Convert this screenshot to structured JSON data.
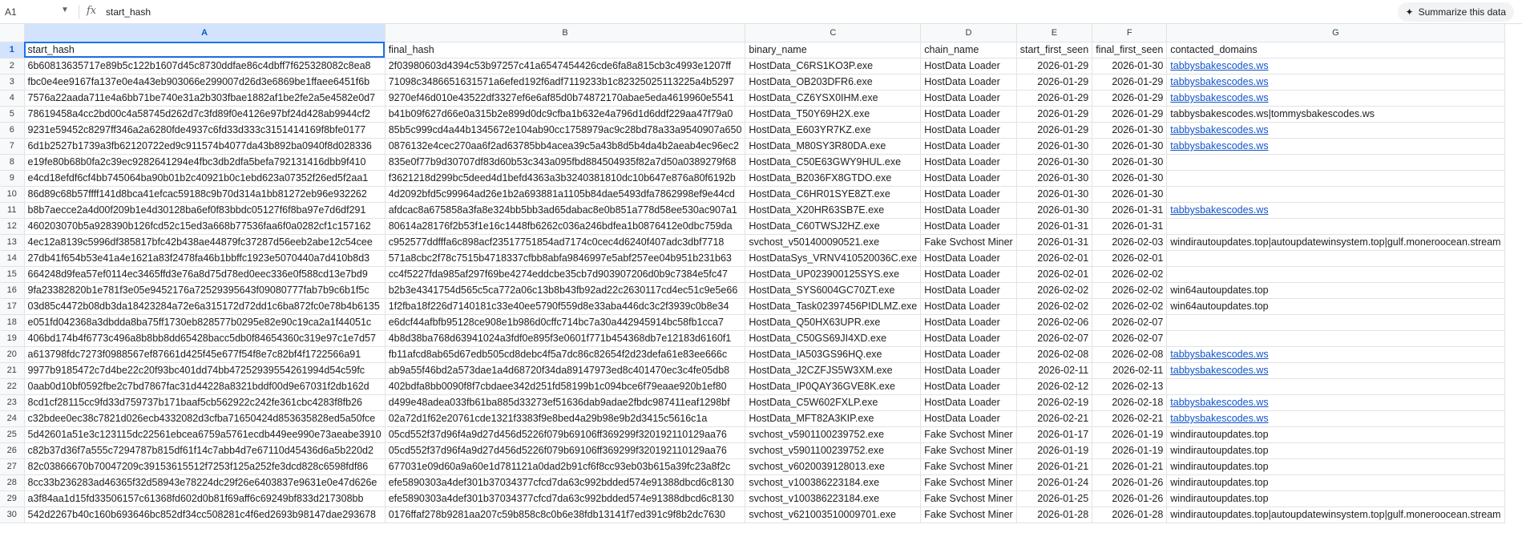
{
  "name_box": "A1",
  "formula": "start_hash",
  "summarize_label": "Summarize this data",
  "columns": [
    "A",
    "B",
    "C",
    "D",
    "E",
    "F",
    "G"
  ],
  "colors": {
    "link": "#1155cc",
    "selection": "#1a73e8",
    "header_active": "#d3e3fd"
  },
  "rows": [
    {
      "n": "1",
      "c": [
        "start_hash",
        "final_hash",
        "binary_name",
        "chain_name",
        "start_first_seen",
        "final_first_seen",
        "contacted_domains"
      ],
      "link": false
    },
    {
      "n": "2",
      "c": [
        "6b60813635717e89b5c122b1607d45c8730ddfae86c4dbff7f625328082c8ea8",
        "2f03980603d4394c53b97257c41a6547454426cde6fa8a815cb3c4993e1207ff",
        "HostData_C6RS1KO3P.exe",
        "HostData Loader",
        "2026-01-29",
        "2026-01-30",
        "tabbysbakescodes.ws"
      ],
      "link": true
    },
    {
      "n": "3",
      "c": [
        "fbc0e4ee9167fa137e0e4a43eb903066e299007d26d3e6869be1ffaee6451f6b",
        "71098c3486651631571a6efed192f6adf7119233b1c82325025113225a4b5297",
        "HostData_OB203DFR6.exe",
        "HostData Loader",
        "2026-01-29",
        "2026-01-29",
        "tabbysbakescodes.ws"
      ],
      "link": true
    },
    {
      "n": "4",
      "c": [
        "7576a22aada711e4a6bb71be740e31a2b303fbae1882af1be2fe2a5e4582e0d7",
        "9270ef46d010e43522df3327ef6e6af85d0b74872170abae5eda4619960e5541",
        "HostData_CZ6YSX0IHM.exe",
        "HostData Loader",
        "2026-01-29",
        "2026-01-29",
        "tabbysbakescodes.ws"
      ],
      "link": true
    },
    {
      "n": "5",
      "c": [
        "78619458a4cc2bd00c4a58745d262d7c3fd89f0e4126e97bf24d428ab9944cf2",
        "b41b09f627d66e0a315b2e899d0dc9cfba1b632e4a796d1d6ddf229aa47f79a0",
        "HostData_T50Y69H2X.exe",
        "HostData Loader",
        "2026-01-29",
        "2026-01-29",
        "tabbysbakescodes.ws|tommysbakescodes.ws"
      ],
      "link": false
    },
    {
      "n": "6",
      "c": [
        "9231e59452c8297ff346a2a6280fde4937c6fd33d333c3151414169f8bfe0177",
        "85b5c999cd4a44b1345672e104ab90cc1758979ac9c28bd78a33a9540907a650",
        "HostData_E603YR7KZ.exe",
        "HostData Loader",
        "2026-01-29",
        "2026-01-30",
        "tabbysbakescodes.ws"
      ],
      "link": true
    },
    {
      "n": "7",
      "c": [
        "6d1b2527b1739a3fb62120722ed9c911574b4077da43b892ba0940f8d028336",
        "0876132e4cec270aa6f2ad63785bb4acea39c5a43b8d5b4da4b2aeab4ec96ec2",
        "HostData_M80SY3R80DA.exe",
        "HostData Loader",
        "2026-01-30",
        "2026-01-30",
        "tabbysbakescodes.ws"
      ],
      "link": true
    },
    {
      "n": "8",
      "c": [
        "e19fe80b68b0fa2c39ec9282641294e4fbc3db2dfa5befa792131416dbb9f410",
        "835e0f77b9d30707df83d60b53c343a095fbd884504935f82a7d50a0389279f68",
        "HostData_C50E63GWY9HUL.exe",
        "HostData Loader",
        "2026-01-30",
        "2026-01-30",
        ""
      ],
      "link": false
    },
    {
      "n": "9",
      "c": [
        "e4cd18efdf6cf4bb745064ba90b01b2c40921b0c1ebd623a07352f26ed5f2aa1",
        "f3621218d299bc5deed4d1befd4363a3b3240381810dc10b647e876a80f6192b",
        "HostData_B2036FX8GTDO.exe",
        "HostData Loader",
        "2026-01-30",
        "2026-01-30",
        ""
      ],
      "link": false
    },
    {
      "n": "10",
      "c": [
        "86d89c68b57ffff141d8bca41efcac59188c9b70d314a1bb81272eb96e932262",
        "4d2092bfd5c99964ad26e1b2a693881a1105b84dae5493dfa7862998ef9e44cd",
        "HostData_C6HR01SYE8ZT.exe",
        "HostData Loader",
        "2026-01-30",
        "2026-01-30",
        ""
      ],
      "link": false
    },
    {
      "n": "11",
      "c": [
        "b8b7aecce2a4d00f209b1e4d30128ba6ef0f83bbdc05127f6f8ba97e7d6df291",
        "afdcac8a675858a3fa8e324bb5bb3ad65dabac8e0b851a778d58ee530ac907a1",
        "HostData_X20HR63SB7E.exe",
        "HostData Loader",
        "2026-01-30",
        "2026-01-31",
        "tabbysbakescodes.ws"
      ],
      "link": true
    },
    {
      "n": "12",
      "c": [
        "460203070b5a928390b126fcd52c15ed3a668b77536faa6f0a0282cf1c157162",
        "80614a28176f2b53f1e16c1448fb6262c036a246bdfea1b0876412e0dbc759da",
        "HostData_C60TWSJ2HZ.exe",
        "HostData Loader",
        "2026-01-31",
        "2026-01-31",
        ""
      ],
      "link": false
    },
    {
      "n": "13",
      "c": [
        "4ec12a8139c5996df385817bfc42b438ae44879fc37287d56eeb2abe12c54cee",
        "c952577ddfffa6c898acf23517751854ad7174c0cec4d6240f407adc3dbf7718",
        "svchost_v501400090521.exe",
        "Fake Svchost Miner",
        "2026-01-31",
        "2026-02-03",
        "windirautoupdates.top|autoupdatewinsystem.top|gulf.moneroocean.stream"
      ],
      "link": false
    },
    {
      "n": "14",
      "c": [
        "27db41f654b53e41a4e1621a83f2478fa46b1bbffc1923e5070440a7d410b8d3",
        "571a8cbc2f78c7515b4718337cfbb8abfa9846997e5abf257ee04b951b231b63",
        "HostDataSys_VRNV410520036C.exe",
        "HostData Loader",
        "2026-02-01",
        "2026-02-01",
        ""
      ],
      "link": false
    },
    {
      "n": "15",
      "c": [
        "664248d9fea57ef0114ec3465ffd3e76a8d75d78ed0eec336e0f588cd13e7bd9",
        "cc4f5227fda985af297f69be4274eddcbe35cb7d903907206d0b9c7384e5fc47",
        "HostData_UP023900125SYS.exe",
        "HostData Loader",
        "2026-02-01",
        "2026-02-02",
        ""
      ],
      "link": false
    },
    {
      "n": "16",
      "c": [
        "9fa23382820b1e781f3e05e9452176a72529395643f09080777fab7b9c6b1f5c",
        "b2b3e4341754d565c5ca772a06c13b8b43fb92ad22c2630117cd4ec51c9e5e66",
        "HostData_SYS6004GC70ZT.exe",
        "HostData Loader",
        "2026-02-02",
        "2026-02-02",
        "win64autoupdates.top"
      ],
      "link": false
    },
    {
      "n": "17",
      "c": [
        "03d85c4472b08db3da18423284a72e6a315172d72dd1c6ba872fc0e78b4b6135",
        "1f2fba18f226d7140181c33e40ee5790f559d8e33aba446dc3c2f3939c0b8e34",
        "HostData_Task02397456PIDLMZ.exe",
        "HostData Loader",
        "2026-02-02",
        "2026-02-02",
        "win64autoupdates.top"
      ],
      "link": false
    },
    {
      "n": "18",
      "c": [
        "e051fd042368a3dbdda8ba75ff1730eb828577b0295e82e90c19ca2a1f44051c",
        "e6dcf44afbfb95128ce908e1b986d0cffc714bc7a30a442945914bc58fb1cca7",
        "HostData_Q50HX63UPR.exe",
        "HostData Loader",
        "2026-02-06",
        "2026-02-07",
        ""
      ],
      "link": false
    },
    {
      "n": "19",
      "c": [
        "406bd174b4f6773c496a8b8bb8dd65428bacc5db0f84654360c319e97c1e7d57",
        "4b8d38ba768d63941024a3fdf0e895f3e0601f771b454368db7e12183d6160f1",
        "HostData_C50GS69JI4XD.exe",
        "HostData Loader",
        "2026-02-07",
        "2026-02-07",
        ""
      ],
      "link": false
    },
    {
      "n": "20",
      "c": [
        "a613798fdc7273f0988567ef87661d425f45e677f54f8e7c82bf4f1722566a91",
        "fb11afcd8ab65d67edb505cd8debc4f5a7dc86c82654f2d23defa61e83ee666c",
        "HostData_IA503GS96HQ.exe",
        "HostData Loader",
        "2026-02-08",
        "2026-02-08",
        "tabbysbakescodes.ws"
      ],
      "link": true
    },
    {
      "n": "21",
      "c": [
        "9977b9185472c7d4be22c20f93bc401dd74bb47252939554261994d54c59fc",
        "ab9a55f46bd2a573dae1a4d68720f34da89147973ed8c401470ec3c4fe05db8",
        "HostData_J2CZFJS5W3XM.exe",
        "HostData Loader",
        "2026-02-11",
        "2026-02-11",
        "tabbysbakescodes.ws"
      ],
      "link": true
    },
    {
      "n": "22",
      "c": [
        "0aab0d10bf0592fbe2c7bd7867fac31d44228a8321bddf00d9e67031f2db162d",
        "402bdfa8bb0090f8f7cbdaee342d251fd58199b1c094bce6f79eaae920b1ef80",
        "HostData_IP0QAY36GVE8K.exe",
        "HostData Loader",
        "2026-02-12",
        "2026-02-13",
        ""
      ],
      "link": false
    },
    {
      "n": "23",
      "c": [
        "8cd1cf28115cc9fd33d759737b171baaf5cb562922c242fe361cbc4283f8fb26",
        "d499e48adea033fb61ba885d33273ef51636dab9adae2fbdc987411eaf1298bf",
        "HostData_C5W602FXLP.exe",
        "HostData Loader",
        "2026-02-19",
        "2026-02-18",
        "tabbysbakescodes.ws"
      ],
      "link": true
    },
    {
      "n": "24",
      "c": [
        "c32bdee0ec38c7821d026ecb4332082d3cfba71650424d853635828ed5a50fce",
        "02a72d1f62e20761cde1321f3383f9e8bed4a29b98e9b2d3415c5616c1a",
        "HostData_MFT82A3KIP.exe",
        "HostData Loader",
        "2026-02-21",
        "2026-02-21",
        "tabbysbakescodes.ws"
      ],
      "link": true
    },
    {
      "n": "25",
      "c": [
        "5d42601a51e3c123115dc22561ebcea6759a5761ecdb449ee990e73aeabe3910",
        "05cd552f37d96f4a9d27d456d5226f079b69106ff369299f320192110129aa76",
        "svchost_v5901100239752.exe",
        "Fake Svchost Miner",
        "2026-01-17",
        "2026-01-19",
        "windirautoupdates.top"
      ],
      "link": false
    },
    {
      "n": "26",
      "c": [
        "c82b37d36f7a555c7294787b815df61f14c7abb4d7e67110d45436d6a5b220d2",
        "05cd552f37d96f4a9d27d456d5226f079b69106ff369299f320192110129aa76",
        "svchost_v5901100239752.exe",
        "Fake Svchost Miner",
        "2026-01-19",
        "2026-01-19",
        "windirautoupdates.top"
      ],
      "link": false
    },
    {
      "n": "27",
      "c": [
        "82c03866670b70047209c39153615512f7253f125a252fe3dcd828c6598fdf86",
        "677031e09d60a9a60e1d781121a0dad2b91cf6f8cc93eb03b615a39fc23a8f2c",
        "svchost_v6020039128013.exe",
        "Fake Svchost Miner",
        "2026-01-21",
        "2026-01-21",
        "windirautoupdates.top"
      ],
      "link": false
    },
    {
      "n": "28",
      "c": [
        "8cc33b236283ad46365f32d58943e78224dc29f26e6403837e9631e0e47d626e",
        "efe5890303a4def301b37034377cfcd7da63c992bdded574e91388dbcd6c8130",
        "svchost_v100386223184.exe",
        "Fake Svchost Miner",
        "2026-01-24",
        "2026-01-26",
        "windirautoupdates.top"
      ],
      "link": false
    },
    {
      "n": "29",
      "c": [
        "a3f84aa1d15fd33506157c61368fd602d0b81f69aff6c69249bf833d217308bb",
        "efe5890303a4def301b37034377cfcd7da63c992bdded574e91388dbcd6c8130",
        "svchost_v100386223184.exe",
        "Fake Svchost Miner",
        "2026-01-25",
        "2026-01-26",
        "windirautoupdates.top"
      ],
      "link": false
    },
    {
      "n": "30",
      "c": [
        "542d2267b40c160b693646bc852df34cc508281c4f6ed2693b98147dae293678",
        "0176ffaf278b9281aa207c59b858c8c0b6e38fdb13141f7ed391c9f8b2dc7630",
        "svchost_v621003510009701.exe",
        "Fake Svchost Miner",
        "2026-01-28",
        "2026-01-28",
        "windirautoupdates.top|autoupdatewinsystem.top|gulf.moneroocean.stream"
      ],
      "link": false
    }
  ]
}
